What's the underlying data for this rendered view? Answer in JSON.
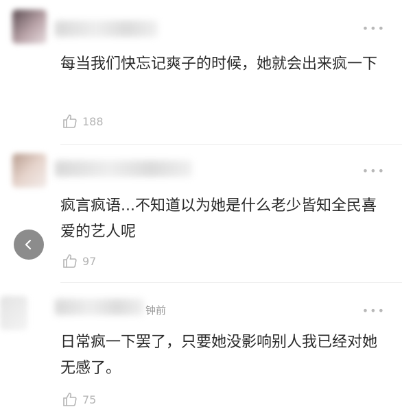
{
  "comments": [
    {
      "text": "每当我们快忘记爽子的时候，她就会出来疯一下",
      "likes": "188",
      "more": "•••"
    },
    {
      "text": "疯言疯语...不知道以为她是什么老少皆知全民喜爱的艺人呢",
      "likes": "97",
      "more": "•••"
    },
    {
      "text": "日常疯一下罢了，只要她没影响别人我已经对她无感了。",
      "likes": "75",
      "more": "•••",
      "time": "钟前"
    }
  ],
  "icons": {
    "like": "thumbs-up-icon",
    "back": "chevron-left-icon",
    "more": "more-dots-icon"
  },
  "colors": {
    "text": "#2a2a2a",
    "muted": "#b4b4b4",
    "overlay_button": "#787878"
  }
}
